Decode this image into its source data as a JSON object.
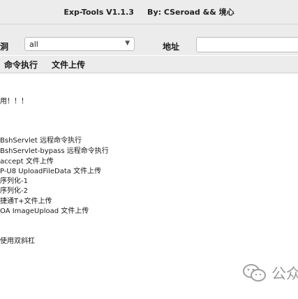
{
  "window": {
    "title": "Exp-Tools V1.1.3     By: CSeroad && 境心"
  },
  "toolbar": {
    "vuln_label": "洞",
    "vuln_select_value": "all",
    "address_label": "地址",
    "address_value": ""
  },
  "tabs": [
    {
      "label": "命令执行"
    },
    {
      "label": "文件上传"
    }
  ],
  "content": {
    "lines": [
      "用！！！",
      "BshServlet 远程命令执行",
      "BshServlet-bypass 远程命令执行",
      "accept 文件上传",
      "P-U8 UploadFileData 文件上传",
      "序列化-1",
      "序列化-2",
      "捷通T+文件上传",
      "OA ImageUpload 文件上传",
      "使用双斜杠"
    ]
  },
  "watermark": {
    "icon": "wechat-icon",
    "text": "公众"
  }
}
